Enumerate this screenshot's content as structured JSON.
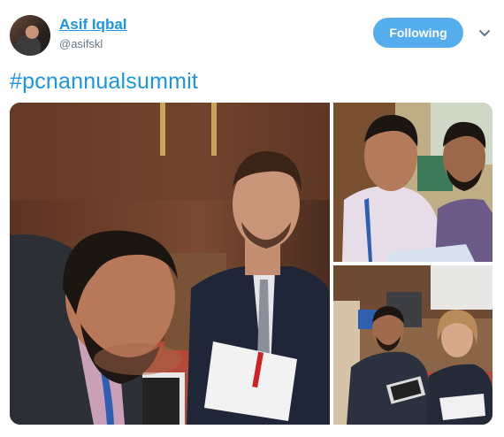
{
  "tweet": {
    "display_name": "Asif Iqbal",
    "handle": "@asifskl",
    "follow_button_label": "Following",
    "text": "#pcnannualsummit"
  },
  "icons": {
    "menu": "chevron-down-icon"
  },
  "colors": {
    "link": "#1b95e0",
    "follow_button": "#55adee",
    "handle": "#657786"
  },
  "media": {
    "photos": [
      "selfie-main",
      "selfie-top-right",
      "table-group-bottom-right"
    ]
  }
}
